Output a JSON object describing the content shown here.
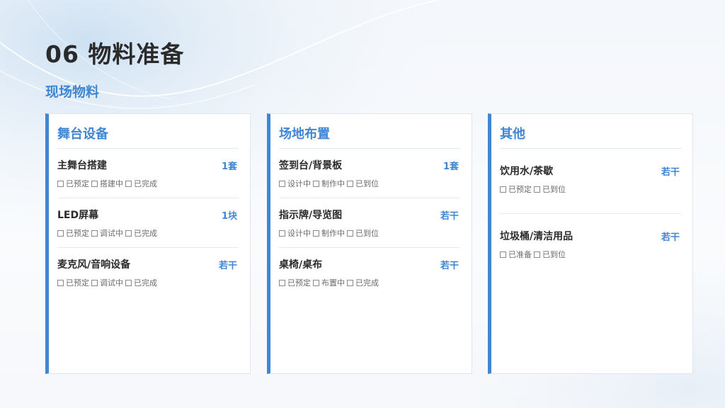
{
  "page": {
    "title": "06 物料准备",
    "subtitle": "现场物料"
  },
  "colors": {
    "accent": "#3f86d3",
    "title_text": "#2a2a2a",
    "card_bg": "#ffffff",
    "divider": "#dbe7f4"
  },
  "cards": [
    {
      "title": "舞台设备",
      "items": [
        {
          "name": "主舞台搭建",
          "qty": "1套",
          "statuses": [
            "已预定",
            "搭建中",
            "已完成"
          ]
        },
        {
          "name": "LED屏幕",
          "qty": "1块",
          "statuses": [
            "已预定",
            "调试中",
            "已完成"
          ]
        },
        {
          "name": "麦克风/音响设备",
          "qty": "若干",
          "statuses": [
            "已预定",
            "调试中",
            "已完成"
          ]
        }
      ]
    },
    {
      "title": "场地布置",
      "items": [
        {
          "name": "签到台/背景板",
          "qty": "1套",
          "statuses": [
            "设计中",
            "制作中",
            "已到位"
          ]
        },
        {
          "name": "指示牌/导览图",
          "qty": "若干",
          "statuses": [
            "设计中",
            "制作中",
            "已到位"
          ]
        },
        {
          "name": "桌椅/桌布",
          "qty": "若干",
          "statuses": [
            "已预定",
            "布置中",
            "已完成"
          ]
        }
      ]
    },
    {
      "title": "其他",
      "items": [
        {
          "name": "饮用水/茶歇",
          "qty": "若干",
          "statuses": [
            "已预定",
            "已到位"
          ]
        },
        {
          "name": "垃圾桶/清洁用品",
          "qty": "若干",
          "statuses": [
            "已准备",
            "已到位"
          ]
        }
      ]
    }
  ]
}
